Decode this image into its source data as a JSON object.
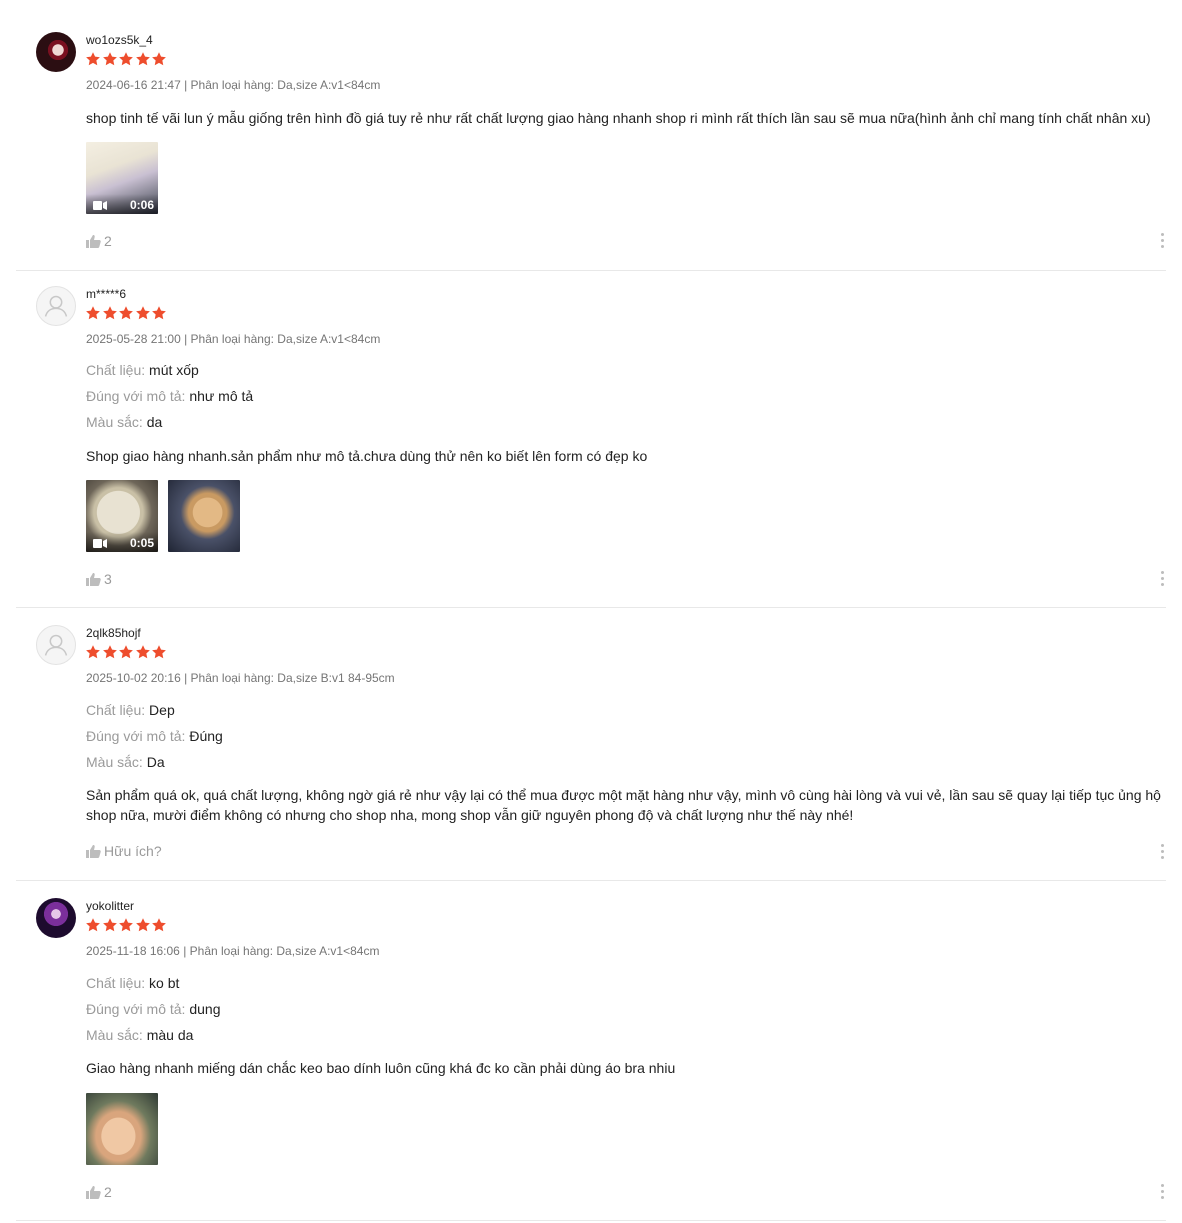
{
  "reviews": [
    {
      "username": "wo1ozs5k_4",
      "avatar": "user-photo",
      "rating": 5,
      "date": "2024-06-16 21:47",
      "variation": "Phân loại hàng: Da,size A:v1<84cm",
      "attributes": [],
      "comment": "shop tinh tế vãi lun ý mẫu giống trên hình đồ giá tuy rẻ như rất chất lượng giao hàng nhanh shop ri mình rất thích lần sau sẽ mua nữa(hình ảnh chỉ mang tính chất nhân xu)",
      "media": [
        {
          "type": "video",
          "duration": "0:06"
        }
      ],
      "likes": "2"
    },
    {
      "username": "m*****6",
      "avatar": "default-user-icon",
      "rating": 5,
      "date": "2025-05-28 21:00",
      "variation": "Phân loại hàng: Da,size A:v1<84cm",
      "attributes": [
        {
          "label": "Chất liệu:",
          "value": "mút xốp"
        },
        {
          "label": "Đúng với mô tả:",
          "value": "như mô tả"
        },
        {
          "label": "Màu sắc:",
          "value": "da"
        }
      ],
      "comment": "Shop giao hàng nhanh.sản phẩm như mô tả.chưa dùng thử nên ko biết lên form có đẹp ko",
      "media": [
        {
          "type": "video",
          "duration": "0:05"
        },
        {
          "type": "image"
        }
      ],
      "likes": "3"
    },
    {
      "username": "2qlk85hojf",
      "avatar": "default-user-icon",
      "rating": 5,
      "date": "2025-10-02 20:16",
      "variation": "Phân loại hàng: Da,size B:v1 84-95cm",
      "attributes": [
        {
          "label": "Chất liệu:",
          "value": "Dep"
        },
        {
          "label": "Đúng với mô tả:",
          "value": "Đúng"
        },
        {
          "label": "Màu sắc:",
          "value": "Da"
        }
      ],
      "comment": "Sản phẩm quá ok, quá chất lượng, không ngờ giá rẻ như vậy lại có thể mua được một mặt hàng như vậy, mình vô cùng hài lòng và vui vẻ, lần sau sẽ quay lại tiếp tục ủng hộ shop nữa, mười điểm không có nhưng cho shop nha, mong shop vẫn giữ nguyên phong độ và chất lượng như thế này nhé!",
      "media": [],
      "likes": "Hữu ích?"
    },
    {
      "username": "yokolitter",
      "avatar": "user-photo",
      "rating": 5,
      "date": "2025-11-18 16:06",
      "variation": "Phân loại hàng: Da,size A:v1<84cm",
      "attributes": [
        {
          "label": "Chất liệu:",
          "value": "ko bt"
        },
        {
          "label": "Đúng với mô tả:",
          "value": "dung"
        },
        {
          "label": "Màu sắc:",
          "value": "màu da"
        }
      ],
      "comment": "Giao hàng nhanh miếng dán chắc keo bao dính luôn cũng khá đc ko cần phải dùng áo bra nhiu",
      "media": [
        {
          "type": "image"
        }
      ],
      "likes": "2"
    }
  ],
  "colors": {
    "star": "#ee4d2d",
    "muted": "#757575",
    "border": "#e8e8e8"
  }
}
